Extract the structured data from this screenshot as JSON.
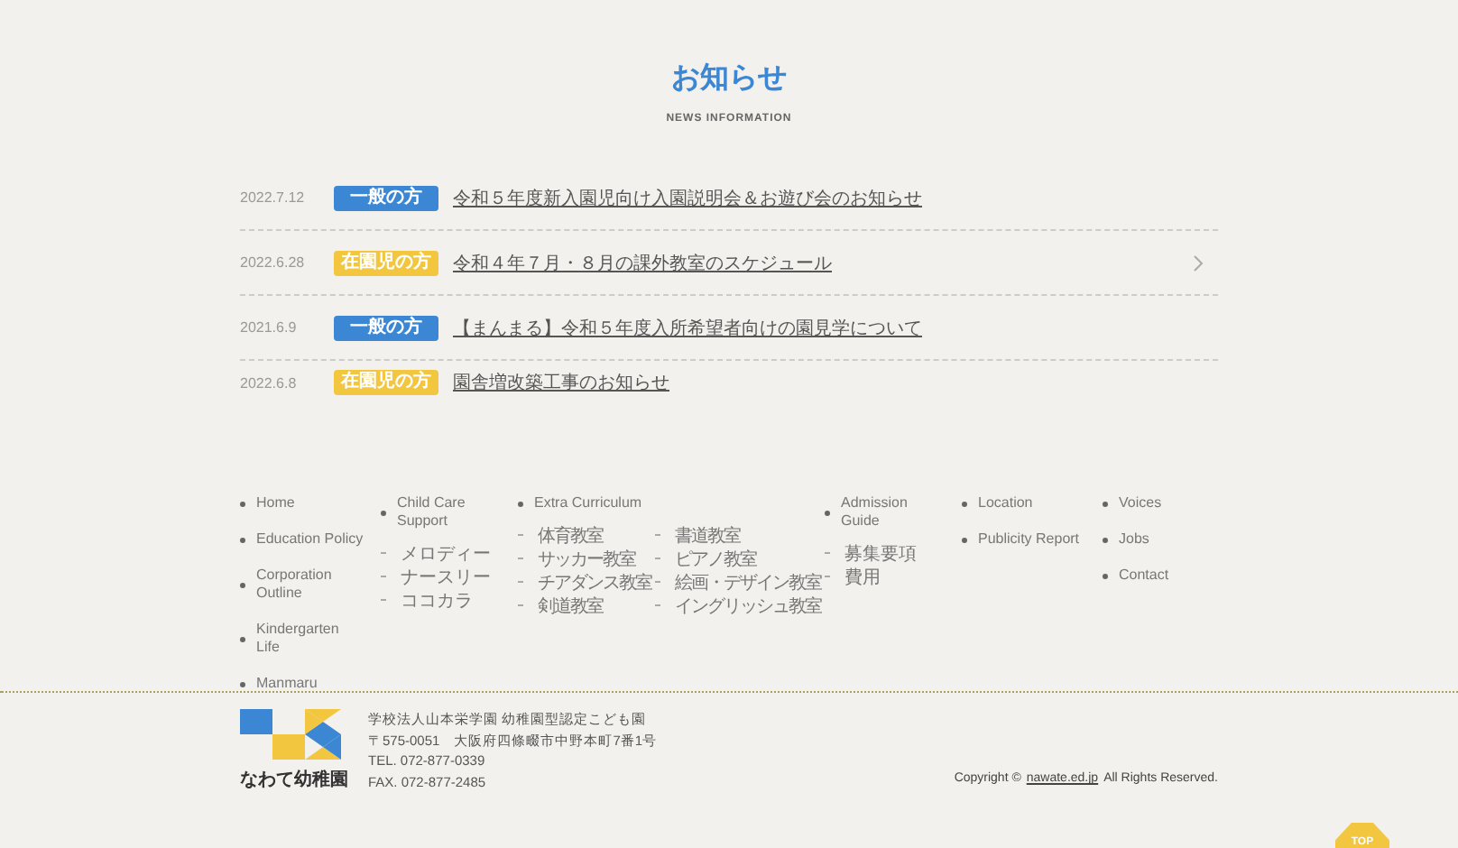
{
  "header": {
    "title": "お知らせ",
    "subtitle": "NEWS INFORMATION"
  },
  "news": [
    {
      "date": "2022.7.12",
      "category": {
        "label": "一般の方",
        "kind": "general"
      },
      "title": "令和５年度新入園児向け入園説明会＆お遊び会のお知らせ",
      "hovered": false
    },
    {
      "date": "2022.6.28",
      "category": {
        "label": "在園児の方",
        "kind": "enrolled"
      },
      "title": "令和４年７月・８月の課外教室のスケジュール",
      "hovered": true
    },
    {
      "date": "2021.6.9",
      "category": {
        "label": "一般の方",
        "kind": "general"
      },
      "title": "【まんまる】令和５年度入所希望者向けの園見学について",
      "hovered": false
    },
    {
      "date": "2022.6.8",
      "category": {
        "label": "在園児の方",
        "kind": "enrolled"
      },
      "title": "園舎増改築工事のお知らせ",
      "hovered": false
    }
  ],
  "footer_nav": [
    {
      "items": [
        {
          "label": "Home"
        },
        {
          "label": "Education Policy"
        },
        {
          "label": "Corporation Outline"
        },
        {
          "label": "Kindergarten Life"
        },
        {
          "label": "Manmaru"
        }
      ]
    },
    {
      "items": [
        {
          "label": "Child Care Support",
          "children": [
            {
              "label": "メロディー"
            },
            {
              "label": "ナースリー"
            },
            {
              "label": "ココカラ"
            }
          ]
        }
      ]
    },
    {
      "items": [
        {
          "label": "Extra Curriculum",
          "children": [
            {
              "label": "体育教室"
            },
            {
              "label": "サッカー教室"
            },
            {
              "label": "チアダンス教室"
            },
            {
              "label": "剣道教室"
            },
            {
              "label": "書道教室"
            },
            {
              "label": "ピアノ教室"
            },
            {
              "label": "絵画・デザイン教室"
            },
            {
              "label": "イングリッシュ教室"
            }
          ]
        }
      ]
    },
    {
      "items": [
        {
          "label": "Admission Guide",
          "children": [
            {
              "label": "募集要項"
            },
            {
              "label": "費用"
            }
          ]
        }
      ]
    },
    {
      "items": [
        {
          "label": "Location"
        },
        {
          "label": "Publicity Report"
        }
      ]
    },
    {
      "items": [
        {
          "label": "Voices"
        },
        {
          "label": "Jobs"
        },
        {
          "label": "Contact"
        }
      ]
    }
  ],
  "footer": {
    "logo_text": "なわて幼稚園",
    "address_lines": [
      "学校法人山本栄学園 幼稚園型認定こども園",
      "〒575-0051　大阪府四條畷市中野本町7番1号",
      "TEL. 072-877-0339",
      "FAX. 072-877-2485"
    ],
    "copyright": {
      "before": "Copyright ©",
      "link": "nawate.ed.jp",
      "after": "All Rights Reserved."
    }
  },
  "top_button": "TOP"
}
